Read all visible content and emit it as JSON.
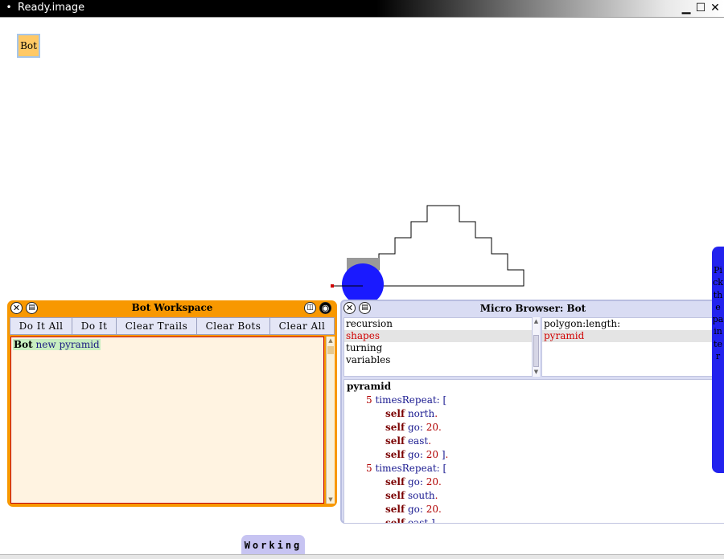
{
  "window": {
    "title": "Ready.image",
    "system_menu_glyph": "•",
    "minimize_glyph": "▁",
    "maximize_glyph": "☐",
    "close_glyph": "✕"
  },
  "world": {
    "bot_tile_label": "Bot"
  },
  "workspace": {
    "title": "Bot Workspace",
    "buttons": [
      "Do It All",
      "Do It",
      "Clear Trails",
      "Clear Bots",
      "Clear All"
    ],
    "code": {
      "receiver": "Bot",
      "message1": "new",
      "message2": "pyramid"
    }
  },
  "browser": {
    "title": "Micro Browser: Bot",
    "categories": [
      "recursion",
      "shapes",
      "turning",
      "variables"
    ],
    "selected_category": "shapes",
    "methods": [
      "polygon:length:",
      "pyramid"
    ],
    "selected_method": "pyramid",
    "code": {
      "selector": "pyramid",
      "lines": [
        {
          "indent": 1,
          "num": "5",
          "msg": "timesRepeat:",
          "rest": "["
        },
        {
          "indent": 2,
          "self": "self",
          "msg": "north",
          "dot": "."
        },
        {
          "indent": 2,
          "self": "self",
          "msg": "go:",
          "num": "20",
          "dot": "."
        },
        {
          "indent": 2,
          "self": "self",
          "msg": "east",
          "dot": "."
        },
        {
          "indent": 2,
          "self": "self",
          "msg": "go:",
          "num": "20",
          "rest": " ]",
          "dot": "."
        },
        {
          "indent": 1,
          "num": "5",
          "msg": "timesRepeat:",
          "rest": "["
        },
        {
          "indent": 2,
          "self": "self",
          "msg": "go:",
          "num": "20",
          "dot": "."
        },
        {
          "indent": 2,
          "self": "self",
          "msg": "south",
          "dot": "."
        },
        {
          "indent": 2,
          "self": "self",
          "msg": "go:",
          "num": "20",
          "dot": "."
        },
        {
          "indent": 2,
          "self": "self",
          "msg": "east",
          "rest": " ]",
          "dot": "."
        }
      ]
    }
  },
  "flap": {
    "label": "Pick the painter"
  },
  "status_tab": {
    "label": "Working"
  },
  "colors": {
    "workspace_frame": "#f89800",
    "browser_frame": "#d9dcf3",
    "flap": "#2222ee",
    "bot_body": "#1a1aff",
    "selection_text": "#d00000"
  }
}
